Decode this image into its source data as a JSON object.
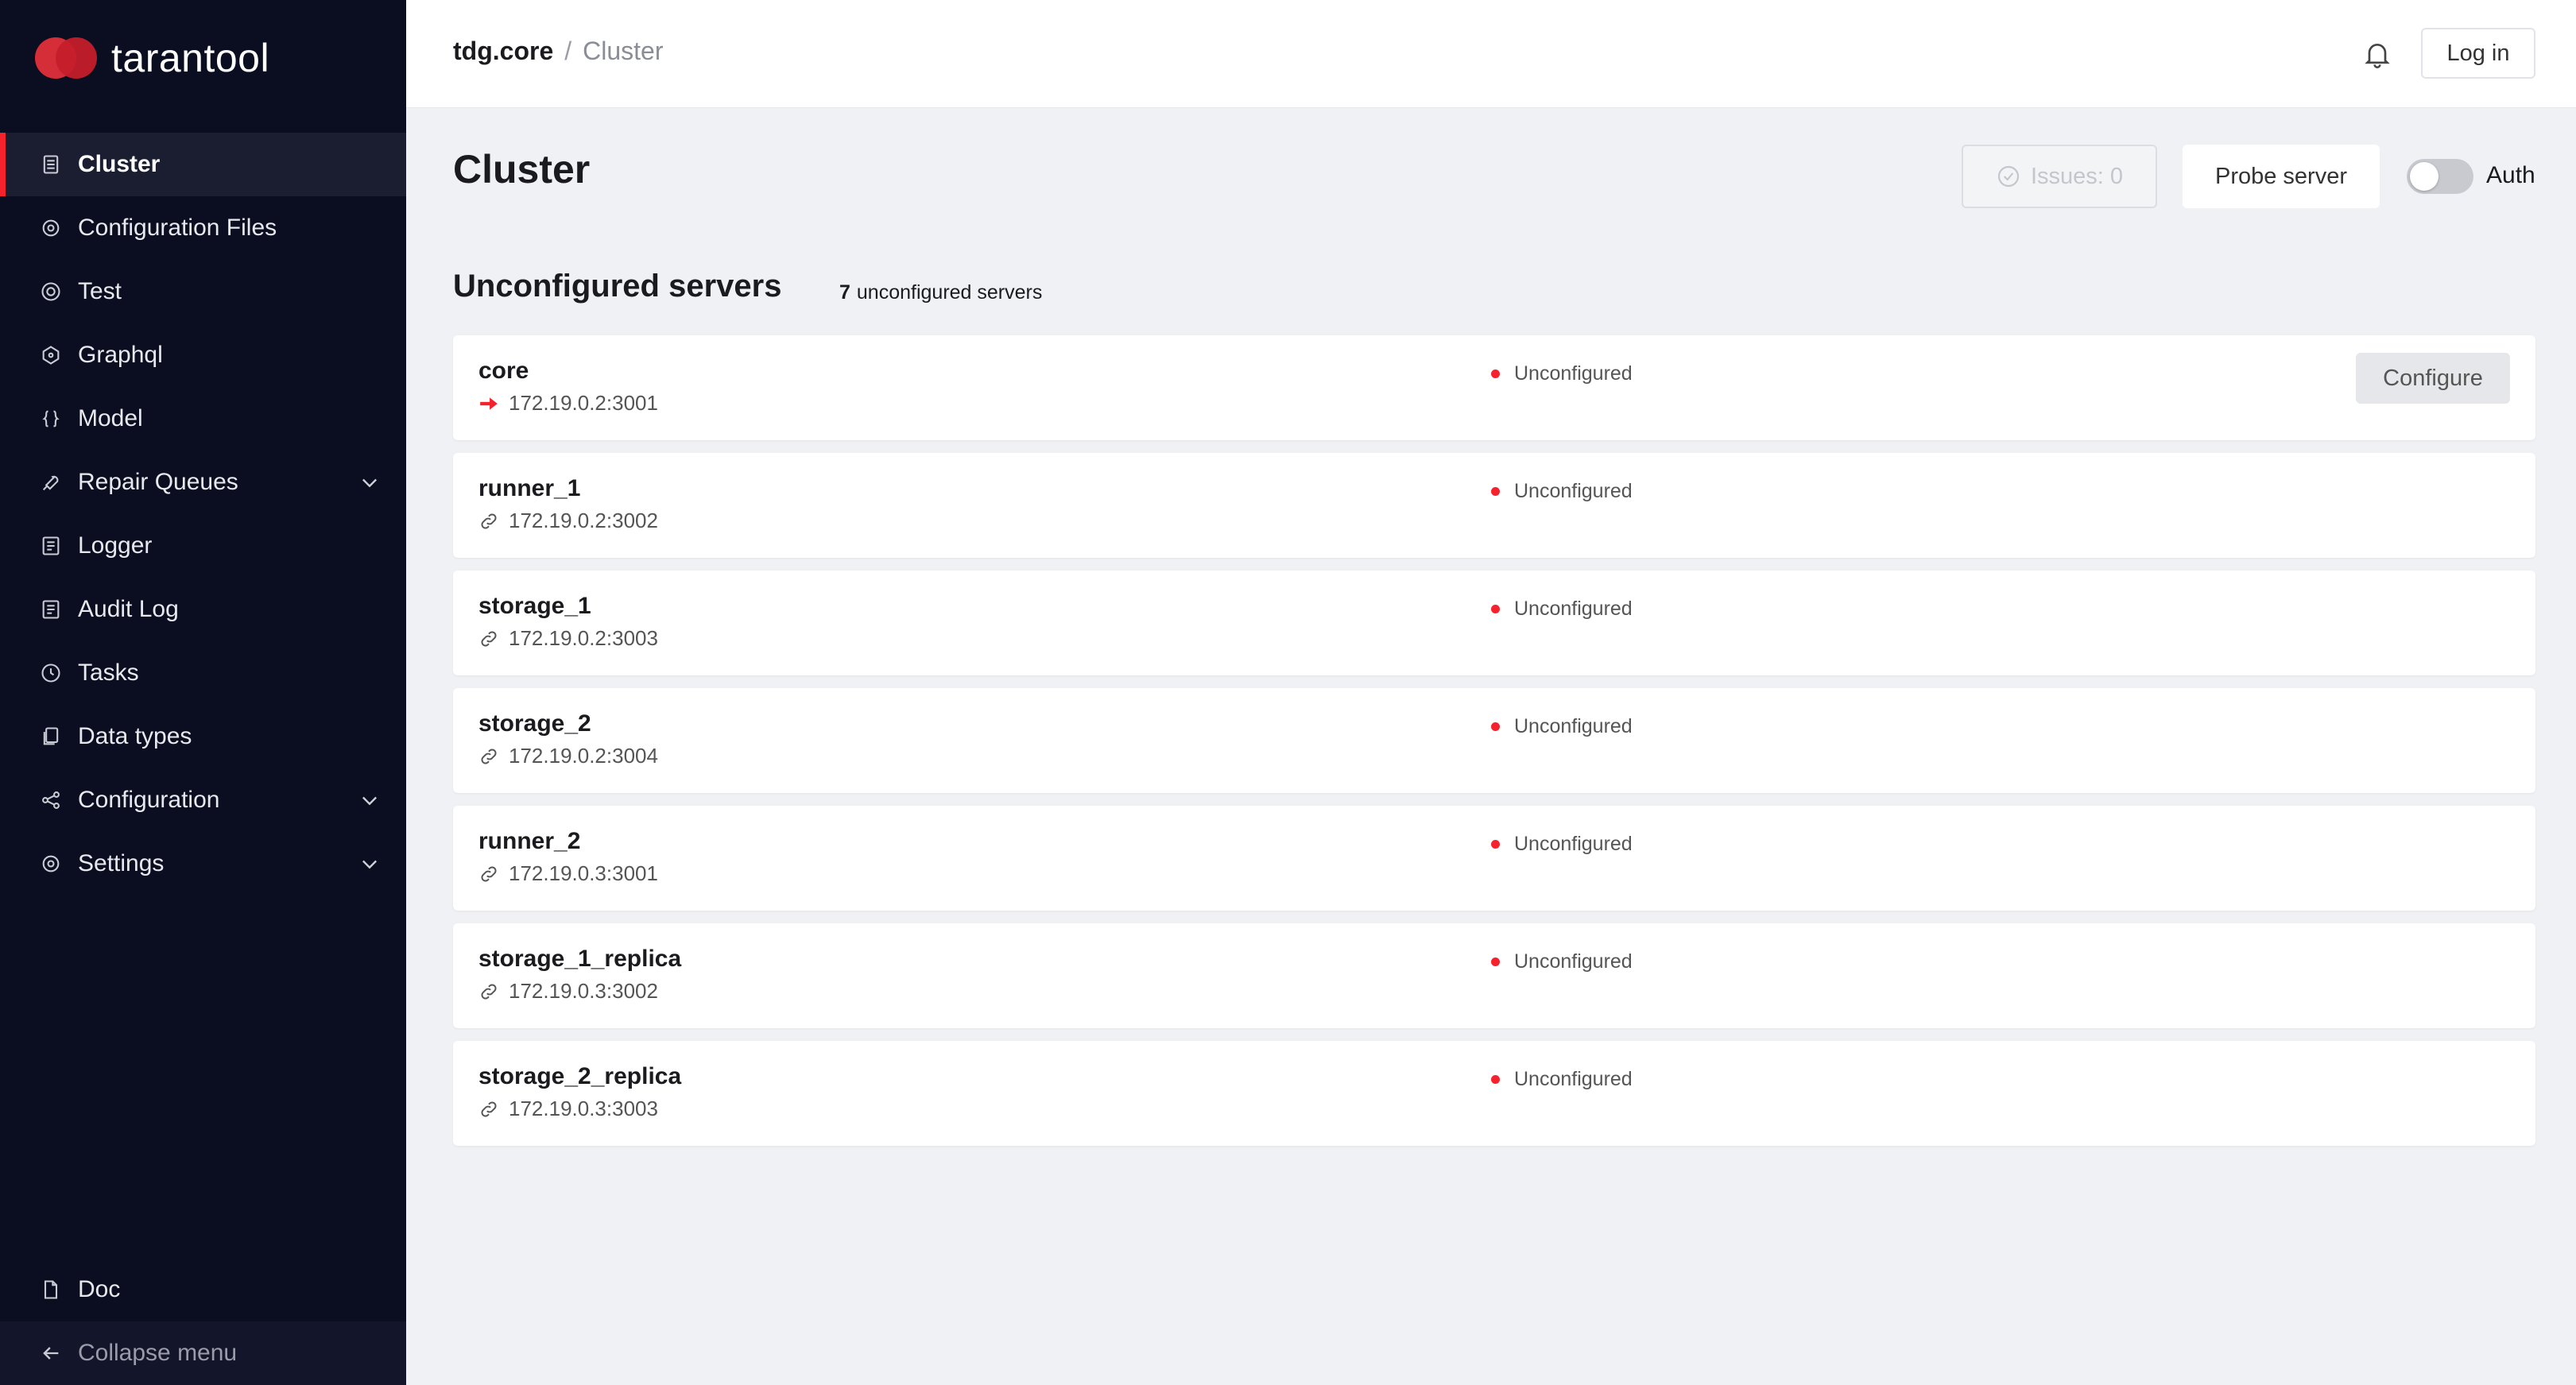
{
  "app": {
    "logo_text": "tarantool",
    "brand_color": "#f5222d"
  },
  "sidebar": {
    "items": [
      {
        "label": "Cluster",
        "icon": "server-icon",
        "active": true
      },
      {
        "label": "Configuration Files",
        "icon": "gear-icon"
      },
      {
        "label": "Test",
        "icon": "target-icon"
      },
      {
        "label": "Graphql",
        "icon": "graphql-icon"
      },
      {
        "label": "Model",
        "icon": "braces-icon"
      },
      {
        "label": "Repair Queues",
        "icon": "wrench-icon",
        "expandable": true
      },
      {
        "label": "Logger",
        "icon": "log-icon"
      },
      {
        "label": "Audit Log",
        "icon": "log-icon"
      },
      {
        "label": "Tasks",
        "icon": "clock-icon"
      },
      {
        "label": "Data types",
        "icon": "files-icon"
      },
      {
        "label": "Configuration",
        "icon": "share-icon",
        "expandable": true
      },
      {
        "label": "Settings",
        "icon": "gear-icon",
        "expandable": true
      }
    ],
    "doc_label": "Doc",
    "collapse_label": "Collapse menu"
  },
  "header": {
    "breadcrumb_root": "tdg.core",
    "breadcrumb_sep": "/",
    "breadcrumb_current": "Cluster",
    "login_label": "Log in"
  },
  "main": {
    "title": "Cluster",
    "issues_label": "Issues: 0",
    "probe_label": "Probe server",
    "auth_label": "Auth",
    "auth_enabled": false,
    "section_title": "Unconfigured servers",
    "count_value": "7",
    "count_text": "unconfigured servers",
    "configure_label": "Configure",
    "servers": [
      {
        "name": "core",
        "uri": "172.19.0.2:3001",
        "status": "Unconfigured",
        "current": true
      },
      {
        "name": "runner_1",
        "uri": "172.19.0.2:3002",
        "status": "Unconfigured"
      },
      {
        "name": "storage_1",
        "uri": "172.19.0.2:3003",
        "status": "Unconfigured"
      },
      {
        "name": "storage_2",
        "uri": "172.19.0.2:3004",
        "status": "Unconfigured"
      },
      {
        "name": "runner_2",
        "uri": "172.19.0.3:3001",
        "status": "Unconfigured"
      },
      {
        "name": "storage_1_replica",
        "uri": "172.19.0.3:3002",
        "status": "Unconfigured"
      },
      {
        "name": "storage_2_replica",
        "uri": "172.19.0.3:3003",
        "status": "Unconfigured"
      }
    ]
  }
}
